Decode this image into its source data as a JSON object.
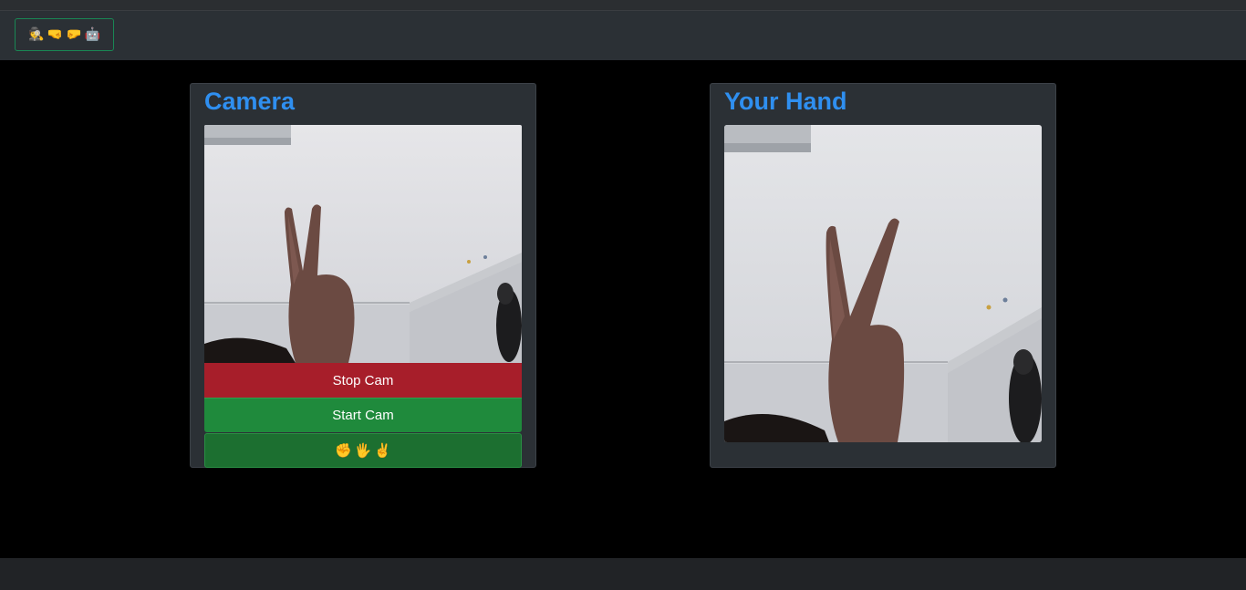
{
  "navbar": {
    "brand_icons": [
      "🕵",
      "🤜",
      "🤛",
      "🤖"
    ]
  },
  "camera_card": {
    "title": "Camera",
    "stop_label": "Stop Cam",
    "start_label": "Start Cam",
    "gesture_icons": [
      "✊",
      "🖐",
      "✌"
    ]
  },
  "hand_card": {
    "title": "Your Hand"
  },
  "colors": {
    "title": "#2f8ff0",
    "stop": "#a71e2a",
    "start": "#1f8a3c",
    "detect": "#1c6f30"
  }
}
